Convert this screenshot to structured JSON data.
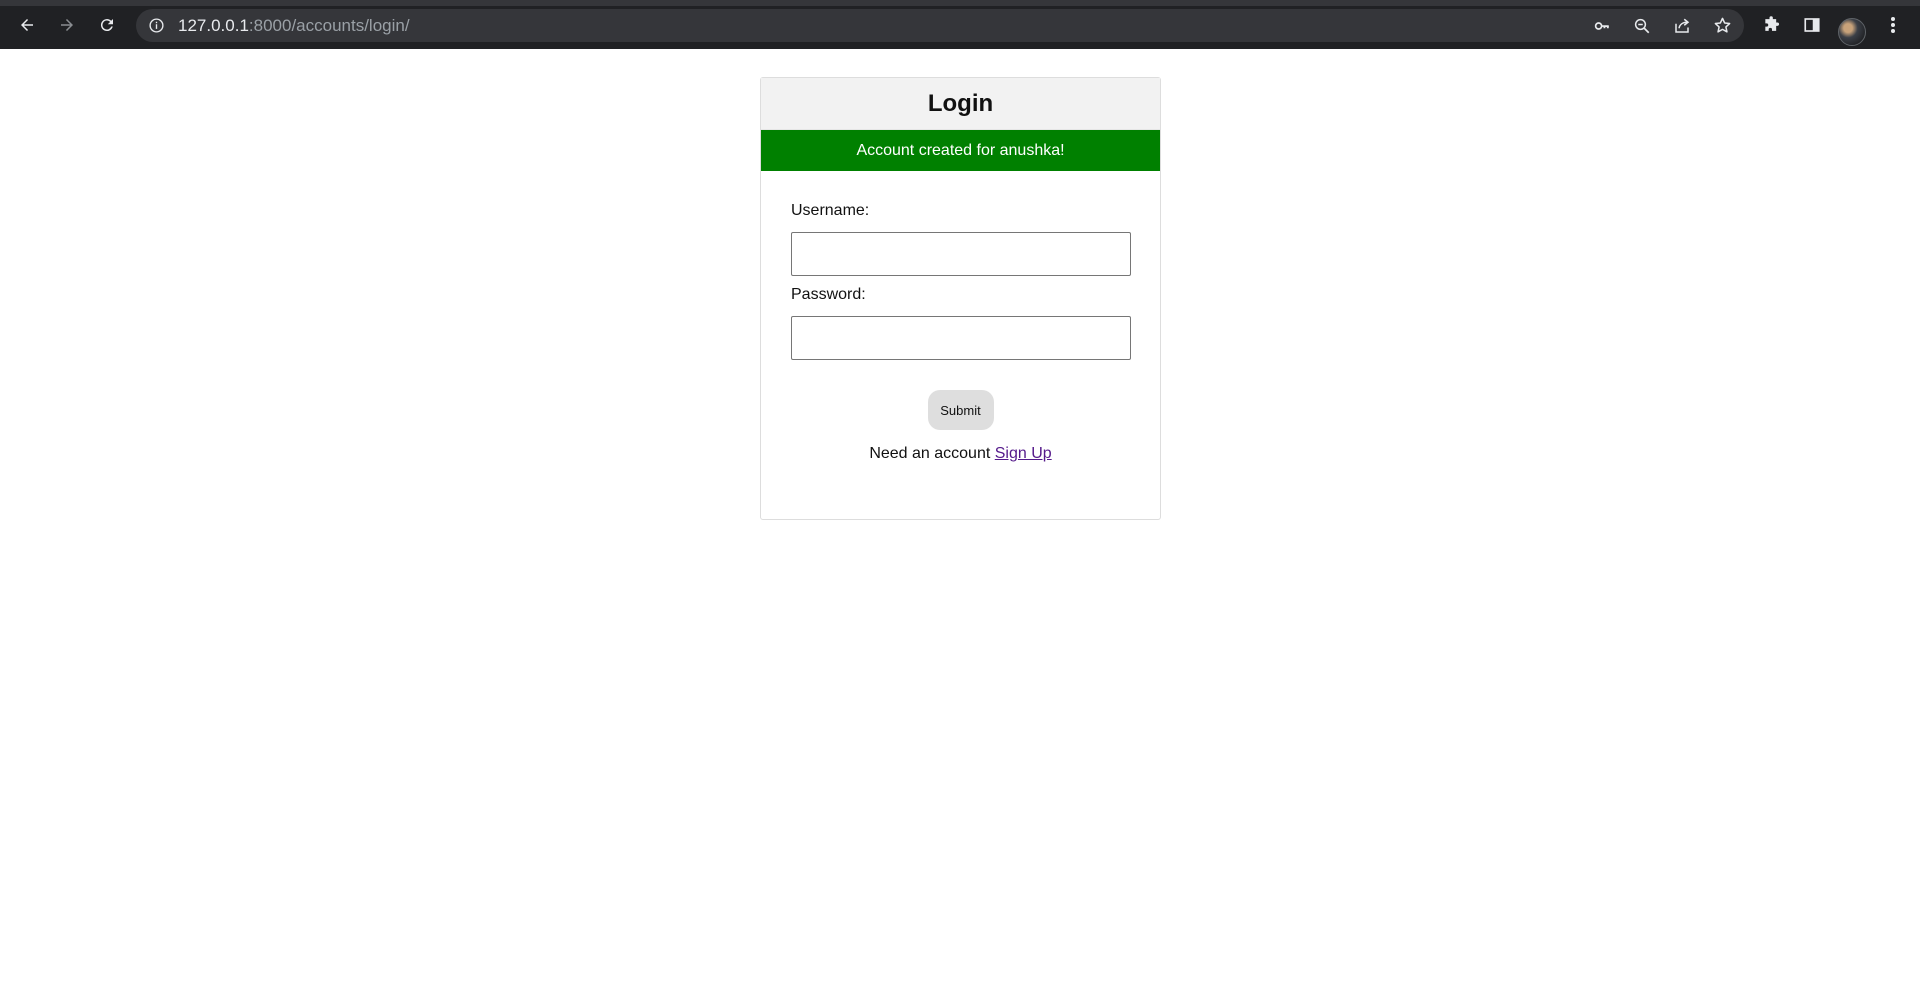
{
  "browser": {
    "url_host": "127.0.0.1",
    "url_rest": ":8000/accounts/login/",
    "icons": [
      "back-arrow-icon",
      "forward-arrow-icon",
      "reload-icon",
      "info-icon",
      "key-icon",
      "zoom-out-icon",
      "share-icon",
      "star-icon",
      "puzzle-icon",
      "side-panel-icon",
      "profile-avatar",
      "kebab-menu-icon"
    ]
  },
  "login": {
    "title": "Login",
    "flash_message": "Account created for anushka!",
    "flash_color": "#008000",
    "username_label": "Username:",
    "username_value": "",
    "password_label": "Password:",
    "password_value": "",
    "submit_label": "Submit",
    "signup_prompt": "Need an account",
    "signup_link": "Sign Up",
    "link_color": "#551a8b"
  }
}
